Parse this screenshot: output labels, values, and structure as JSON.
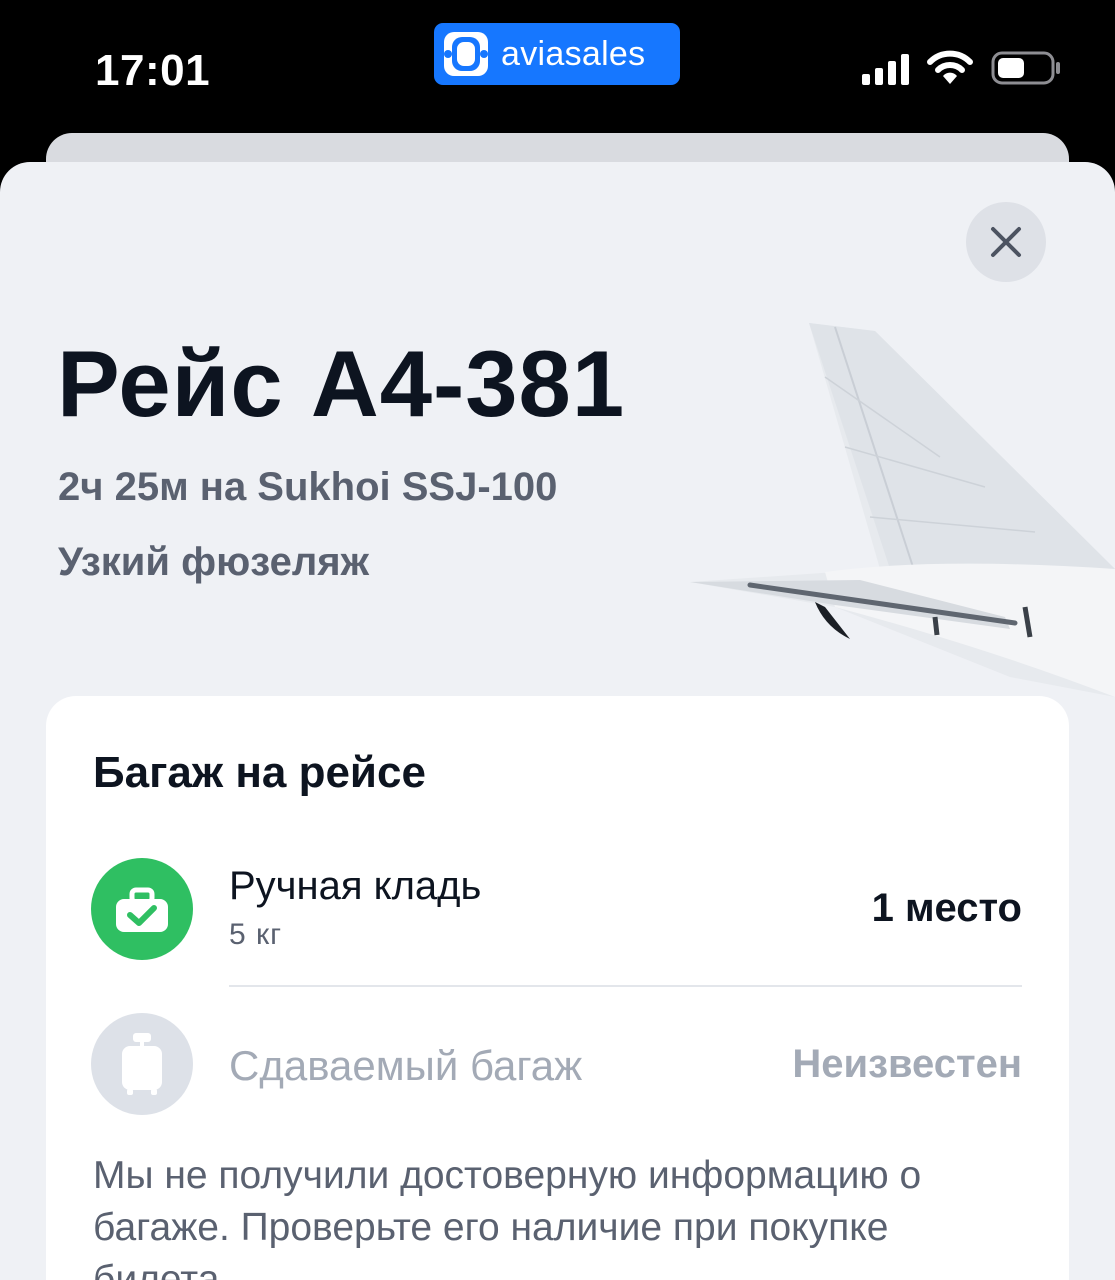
{
  "status_bar": {
    "time": "17:01",
    "brand": "aviasales",
    "icons": [
      "cellular-signal-icon",
      "wifi-icon",
      "battery-icon"
    ]
  },
  "flight": {
    "title": "Рейс A4-381",
    "subtitle": "2ч 25м на Sukhoi SSJ-100",
    "body_type": "Узкий фюзеляж"
  },
  "baggage": {
    "title": "Багаж на рейсе",
    "hand_luggage": {
      "label": "Ручная кладь",
      "weight": "5 кг",
      "quantity": "1 место",
      "icon": "carry-on-check-icon",
      "icon_color": "#2fbf62"
    },
    "checked_luggage": {
      "label": "Сдаваемый багаж",
      "status": "Неизвестен",
      "icon": "suitcase-icon",
      "icon_color": "#dde1e8"
    },
    "note": "Мы не получили достоверную информацию о багаже. Проверьте его наличие при покупке билета."
  },
  "colors": {
    "brand_blue": "#1677ff",
    "sheet_bg": "#eff1f5",
    "text_primary": "#0d1420",
    "text_secondary": "#5a6170",
    "text_muted": "#a3aab6"
  }
}
